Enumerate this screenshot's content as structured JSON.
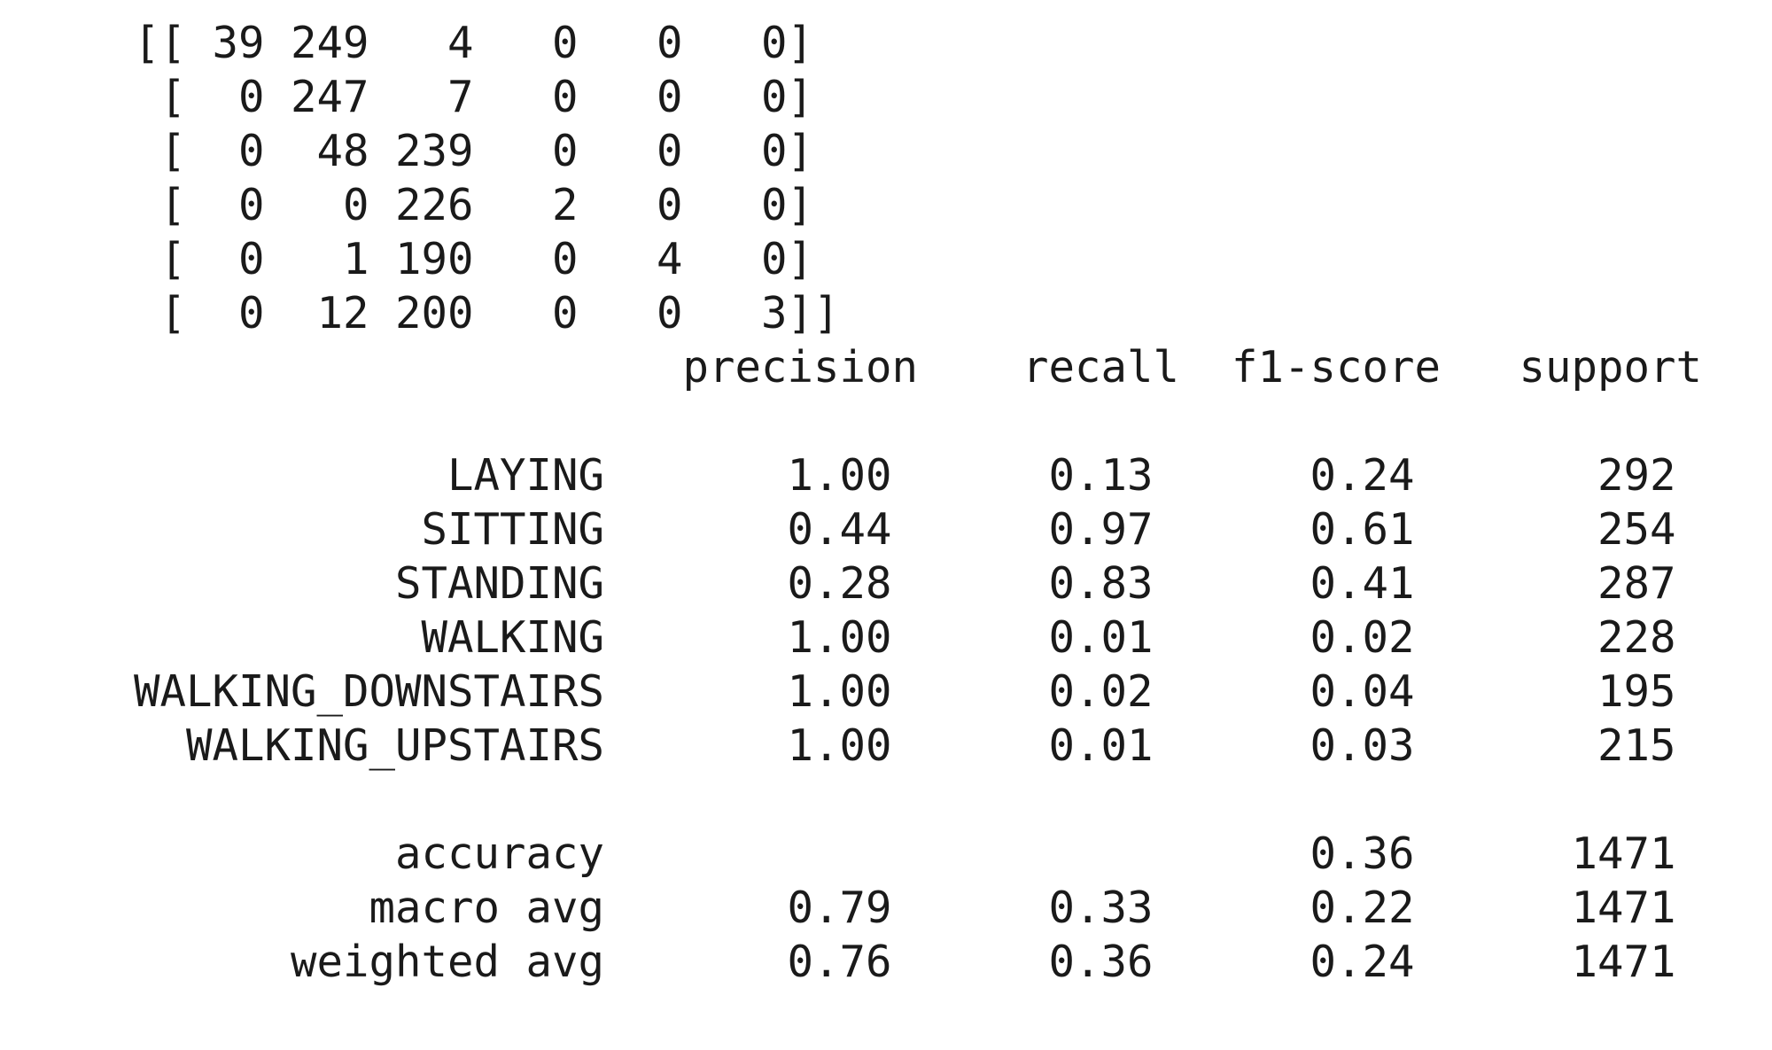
{
  "confusion_matrix": {
    "rows": [
      [
        39,
        249,
        4,
        0,
        0,
        0
      ],
      [
        0,
        247,
        7,
        0,
        0,
        0
      ],
      [
        0,
        48,
        239,
        0,
        0,
        0
      ],
      [
        0,
        0,
        226,
        2,
        0,
        0
      ],
      [
        0,
        1,
        190,
        0,
        4,
        0
      ],
      [
        0,
        12,
        200,
        0,
        0,
        3
      ]
    ]
  },
  "report": {
    "headers": [
      "precision",
      "recall",
      "f1-score",
      "support"
    ],
    "classes": [
      {
        "label": "LAYING",
        "precision": "1.00",
        "recall": "0.13",
        "f1": "0.24",
        "support": "292"
      },
      {
        "label": "SITTING",
        "precision": "0.44",
        "recall": "0.97",
        "f1": "0.61",
        "support": "254"
      },
      {
        "label": "STANDING",
        "precision": "0.28",
        "recall": "0.83",
        "f1": "0.41",
        "support": "287"
      },
      {
        "label": "WALKING",
        "precision": "1.00",
        "recall": "0.01",
        "f1": "0.02",
        "support": "228"
      },
      {
        "label": "WALKING_DOWNSTAIRS",
        "precision": "1.00",
        "recall": "0.02",
        "f1": "0.04",
        "support": "195"
      },
      {
        "label": "WALKING_UPSTAIRS",
        "precision": "1.00",
        "recall": "0.01",
        "f1": "0.03",
        "support": "215"
      }
    ],
    "accuracy": {
      "label": "accuracy",
      "f1": "0.36",
      "support": "1471"
    },
    "macro_avg": {
      "label": "macro avg",
      "precision": "0.79",
      "recall": "0.33",
      "f1": "0.22",
      "support": "1471"
    },
    "weighted_avg": {
      "label": "weighted avg",
      "precision": "0.76",
      "recall": "0.36",
      "f1": "0.24",
      "support": "1471"
    }
  }
}
